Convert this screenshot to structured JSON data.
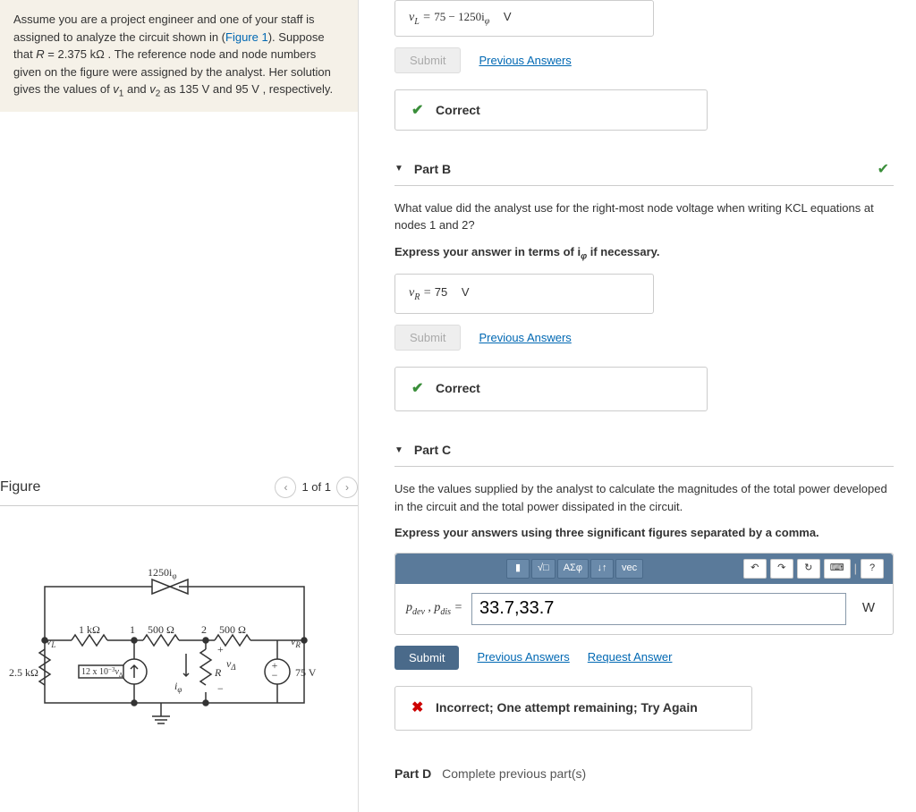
{
  "problem": {
    "text_parts": {
      "p1": "Assume you are a project engineer and one of your staff is assigned to analyze the circuit shown in (",
      "fig_link": "Figure 1",
      "p2": "). Suppose that ",
      "r_var": "R",
      "p3": " = 2.375 ",
      "unit_k": "kΩ",
      "p4": " . The reference node and node numbers given on the figure were assigned by the analyst. Her solution gives the values of ",
      "v1": "v",
      "v1_sub": "1",
      "p5": " and ",
      "v2": "v",
      "v2_sub": "2",
      "p6": " as 135  ",
      "unit_v1": "V",
      "p7": " and 95 ",
      "unit_v2": "V",
      "p8": " , respectively."
    }
  },
  "figure": {
    "title": "Figure",
    "count": "1 of 1",
    "labels": {
      "top_src": "1250i",
      "top_src_sub": "φ",
      "r_1k": "1 kΩ",
      "n1": "1",
      "r_500a": "500 Ω",
      "n2": "2",
      "r_500b": "500 Ω",
      "vL": "v",
      "vL_sub": "L",
      "vR": "v",
      "vR_sub": "R",
      "r_25k": "2.5 kΩ",
      "src_12x": "12 x 10",
      "src_12x_sup": "−3",
      "src_12x_var": "v",
      "src_12x_sub": "Δ",
      "iphi": "i",
      "iphi_sub": "φ",
      "vdelta": "v",
      "vdelta_sub": "Δ",
      "r_R": "R",
      "v75": "75 V"
    }
  },
  "top_answer": {
    "lhs": "v",
    "lhs_sub": "L",
    "eq": " = ",
    "rhs": "75 − 1250i",
    "rhs_sub": "φ",
    "unit": "V",
    "submit": "Submit",
    "prev": "Previous Answers",
    "correct": "Correct"
  },
  "partB": {
    "title": "Part B",
    "instruction": "What value did the analyst use for the right-most node voltage when writing KCL equations at nodes 1 and 2?",
    "bold": "Express your answer in terms of i",
    "bold_sub": "φ",
    "bold2": " if necessary.",
    "ans_lhs": "v",
    "ans_sub": "R",
    "ans_eq": " = ",
    "ans_rhs": "75",
    "ans_unit": "V",
    "submit": "Submit",
    "prev": "Previous Answers",
    "correct": "Correct"
  },
  "partC": {
    "title": "Part C",
    "instruction": "Use the values supplied by the analyst to calculate the magnitudes of the total power developed in the circuit and the total power dissipated in the circuit.",
    "bold": "Express your answers using three significant figures separated by a comma.",
    "toolbar": {
      "t1": "▮",
      "t2": "√□",
      "t3": "ΑΣφ",
      "t4": "↓↑",
      "t5": "vec",
      "undo": "↶",
      "redo": "↷",
      "reset": "↻",
      "keyboard": "⌨",
      "help": "?"
    },
    "eq_label_p1": "p",
    "eq_label_s1": "dev",
    "eq_label_c": " , ",
    "eq_label_p2": "p",
    "eq_label_s2": "dis",
    "eq_label_eq": " = ",
    "eq_value": "33.7,33.7",
    "eq_unit": "W",
    "submit": "Submit",
    "prev": "Previous Answers",
    "request": "Request Answer",
    "incorrect": "Incorrect; One attempt remaining; Try Again"
  },
  "partD": {
    "label": "Part D",
    "text": "Complete previous part(s)"
  }
}
